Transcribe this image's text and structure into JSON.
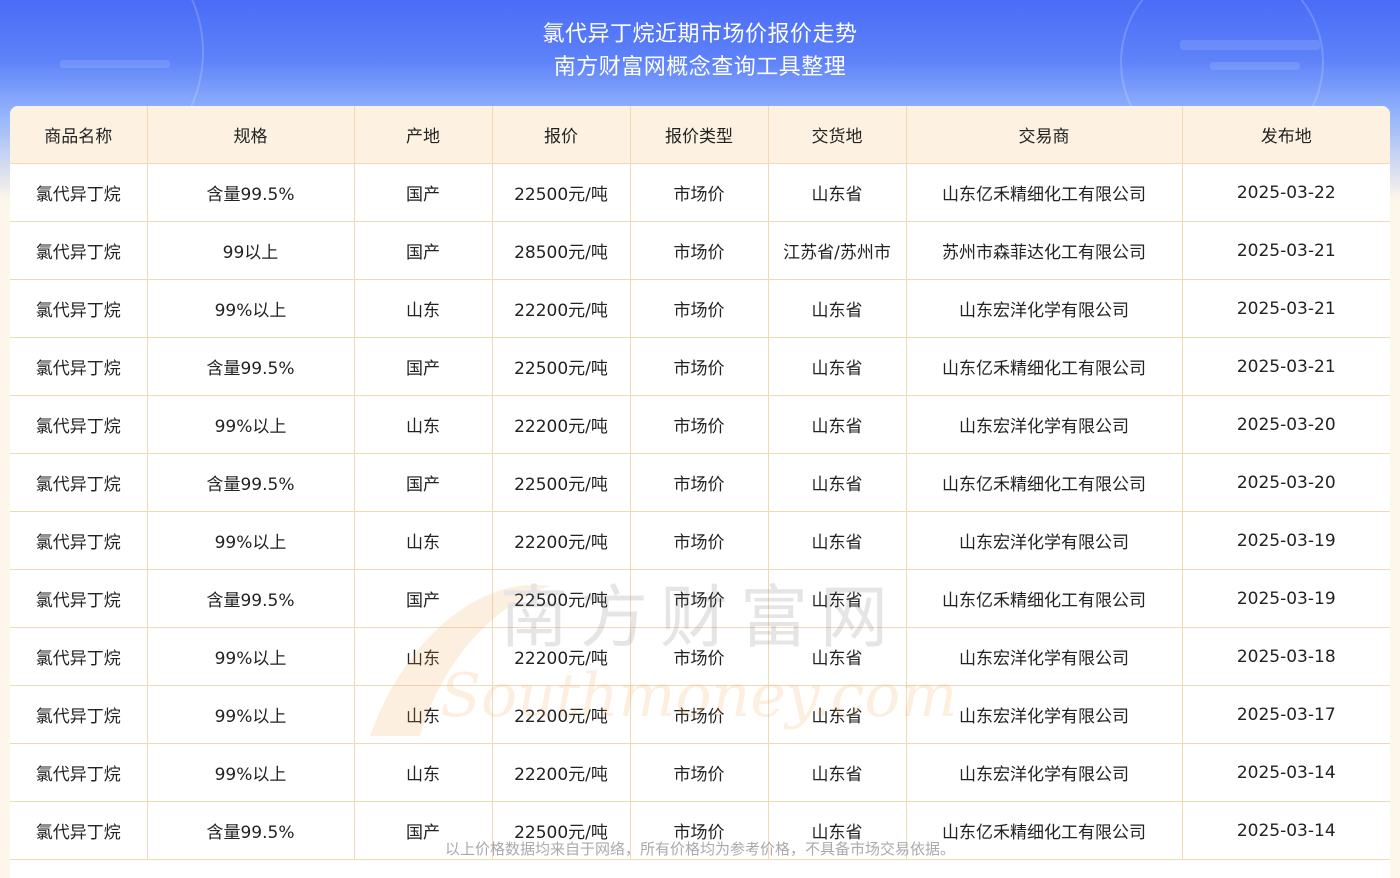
{
  "header": {
    "title": "氯代异丁烷近期市场价报价走势",
    "subtitle": "南方财富网概念查询工具整理"
  },
  "table": {
    "columns": [
      "商品名称",
      "规格",
      "产地",
      "报价",
      "报价类型",
      "交货地",
      "交易商",
      "发布地"
    ],
    "rows": [
      [
        "氯代异丁烷",
        "含量99.5%",
        "国产",
        "22500元/吨",
        "市场价",
        "山东省",
        "山东亿禾精细化工有限公司",
        "2025-03-22"
      ],
      [
        "氯代异丁烷",
        "99以上",
        "国产",
        "28500元/吨",
        "市场价",
        "江苏省/苏州市",
        "苏州市森菲达化工有限公司",
        "2025-03-21"
      ],
      [
        "氯代异丁烷",
        "99%以上",
        "山东",
        "22200元/吨",
        "市场价",
        "山东省",
        "山东宏洋化学有限公司",
        "2025-03-21"
      ],
      [
        "氯代异丁烷",
        "含量99.5%",
        "国产",
        "22500元/吨",
        "市场价",
        "山东省",
        "山东亿禾精细化工有限公司",
        "2025-03-21"
      ],
      [
        "氯代异丁烷",
        "99%以上",
        "山东",
        "22200元/吨",
        "市场价",
        "山东省",
        "山东宏洋化学有限公司",
        "2025-03-20"
      ],
      [
        "氯代异丁烷",
        "含量99.5%",
        "国产",
        "22500元/吨",
        "市场价",
        "山东省",
        "山东亿禾精细化工有限公司",
        "2025-03-20"
      ],
      [
        "氯代异丁烷",
        "99%以上",
        "山东",
        "22200元/吨",
        "市场价",
        "山东省",
        "山东宏洋化学有限公司",
        "2025-03-19"
      ],
      [
        "氯代异丁烷",
        "含量99.5%",
        "国产",
        "22500元/吨",
        "市场价",
        "山东省",
        "山东亿禾精细化工有限公司",
        "2025-03-19"
      ],
      [
        "氯代异丁烷",
        "99%以上",
        "山东",
        "22200元/吨",
        "市场价",
        "山东省",
        "山东宏洋化学有限公司",
        "2025-03-18"
      ],
      [
        "氯代异丁烷",
        "99%以上",
        "山东",
        "22200元/吨",
        "市场价",
        "山东省",
        "山东宏洋化学有限公司",
        "2025-03-17"
      ],
      [
        "氯代异丁烷",
        "99%以上",
        "山东",
        "22200元/吨",
        "市场价",
        "山东省",
        "山东宏洋化学有限公司",
        "2025-03-14"
      ],
      [
        "氯代异丁烷",
        "含量99.5%",
        "国产",
        "22500元/吨",
        "市场价",
        "山东省",
        "山东亿禾精细化工有限公司",
        "2025-03-14"
      ]
    ]
  },
  "footnote": "以上价格数据均来自于网络，所有价格均为参考价格，不具备市场交易依据。",
  "watermark": {
    "cn": "南方财富网",
    "en": "Southmoney.com"
  },
  "colors": {
    "header_blue": "#4a6cf7",
    "table_header_bg": "#fdf2e2",
    "grid_line": "#f1d9b5",
    "footnote_text": "#aaaaaa"
  }
}
